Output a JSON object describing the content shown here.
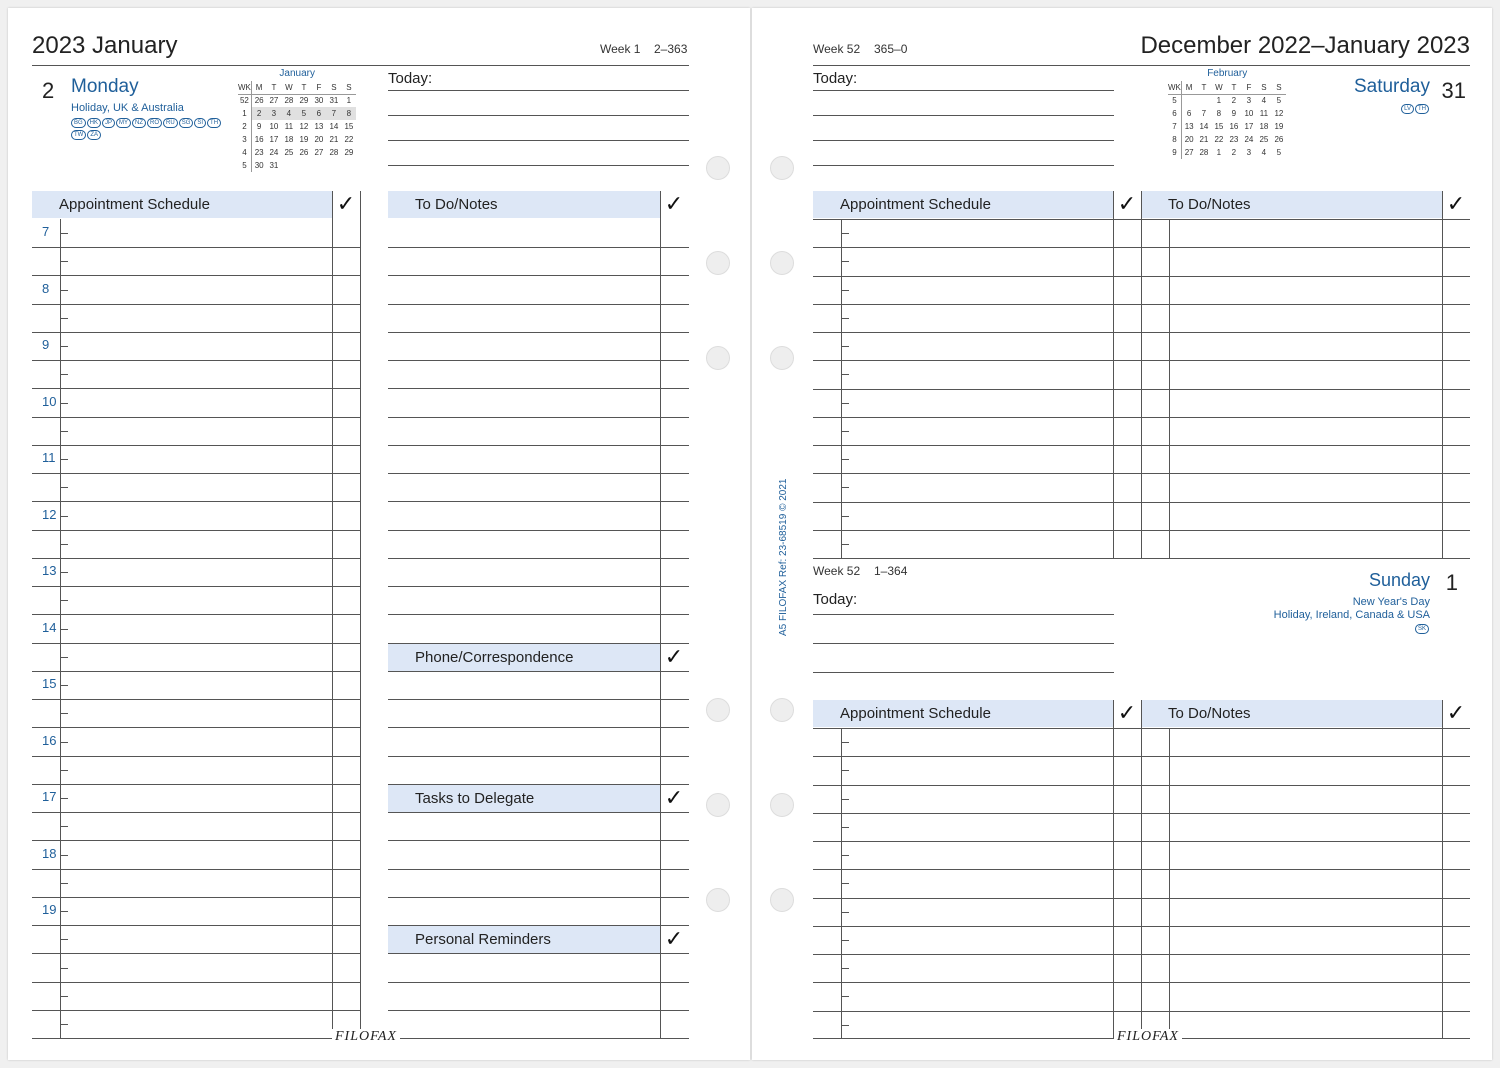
{
  "left": {
    "title": "2023 January",
    "week_label": "Week 1",
    "day_count": "2–363",
    "day_number": "2",
    "day_name": "Monday",
    "holiday": "Holiday, UK & Australia",
    "badges": [
      "BG",
      "HK",
      "JP",
      "MY",
      "NZ",
      "RO",
      "RU",
      "SG",
      "SI",
      "TH",
      "TW",
      "ZA"
    ],
    "mini_cal": {
      "month": "January",
      "headers": [
        "WK",
        "M",
        "T",
        "W",
        "T",
        "F",
        "S",
        "S"
      ],
      "rows": [
        [
          "52",
          "26",
          "27",
          "28",
          "29",
          "30",
          "31",
          "1"
        ],
        [
          "1",
          "2",
          "3",
          "4",
          "5",
          "6",
          "7",
          "8"
        ],
        [
          "2",
          "9",
          "10",
          "11",
          "12",
          "13",
          "14",
          "15"
        ],
        [
          "3",
          "16",
          "17",
          "18",
          "19",
          "20",
          "21",
          "22"
        ],
        [
          "4",
          "23",
          "24",
          "25",
          "26",
          "27",
          "28",
          "29"
        ],
        [
          "5",
          "30",
          "31",
          "",
          "",
          "",
          "",
          ""
        ]
      ]
    },
    "today_label": "Today:",
    "appointment_header": "Appointment Schedule",
    "todo_header": "To Do/Notes",
    "phone_header": "Phone/Correspondence",
    "tasks_header": "Tasks to Delegate",
    "reminders_header": "Personal Reminders",
    "check": "✓",
    "hours": [
      "7",
      "8",
      "9",
      "10",
      "11",
      "12",
      "13",
      "14",
      "15",
      "16",
      "17",
      "18",
      "19"
    ],
    "brand": "FILOFAX"
  },
  "right": {
    "title": "December 2022–January 2023",
    "week_label": "Week 52",
    "day_count": "365–0",
    "day_name": "Saturday",
    "day_number": "31",
    "badges": [
      "LV",
      "TH"
    ],
    "mini_cal": {
      "month": "February",
      "headers": [
        "WK",
        "M",
        "T",
        "W",
        "T",
        "F",
        "S",
        "S"
      ],
      "rows": [
        [
          "5",
          "",
          "",
          "1",
          "2",
          "3",
          "4",
          "5"
        ],
        [
          "6",
          "6",
          "7",
          "8",
          "9",
          "10",
          "11",
          "12"
        ],
        [
          "7",
          "13",
          "14",
          "15",
          "16",
          "17",
          "18",
          "19"
        ],
        [
          "8",
          "20",
          "21",
          "22",
          "23",
          "24",
          "25",
          "26"
        ],
        [
          "9",
          "27",
          "28",
          "1",
          "2",
          "3",
          "4",
          "5"
        ]
      ]
    },
    "today_label": "Today:",
    "appointment_header": "Appointment Schedule",
    "todo_header": "To Do/Notes",
    "check": "✓",
    "sunday": {
      "week_label": "Week 52",
      "day_count": "1–364",
      "day_name": "Sunday",
      "day_number": "1",
      "holiday_1": "New Year's Day",
      "holiday_2": "Holiday, Ireland, Canada & USA",
      "badges": [
        "SK"
      ],
      "today_label": "Today:"
    },
    "ref_text": "A5  FILOFAX  Ref: 23-68519  © 2021",
    "brand": "FILOFAX"
  }
}
